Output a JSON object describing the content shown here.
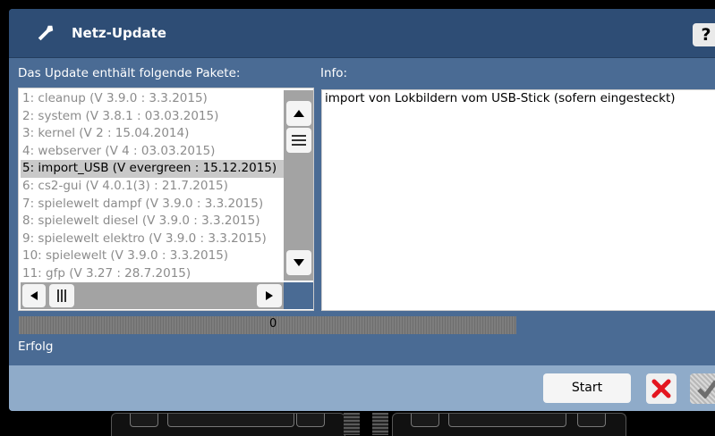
{
  "window": {
    "title": "Netz-Update",
    "help_label": "?"
  },
  "labels": {
    "packages": "Das Update enthält folgende Pakete:",
    "info": "Info:"
  },
  "packages": [
    "1: cleanup (V 3.9.0 : 3.3.2015)",
    "2: system (V 3.8.1 : 03.03.2015)",
    "3: kernel (V 2 : 15.04.2014)",
    "4: webserver (V 4 : 03.03.2015)",
    "5: import_USB (V evergreen : 15.12.2015)",
    "6: cs2-gui (V 4.0.1(3) : 21.7.2015)",
    "7: spielewelt dampf (V 3.9.0 : 3.3.2015)",
    "8: spielewelt diesel (V 3.9.0 : 3.3.2015)",
    "9: spielewelt elektro (V 3.9.0 : 3.3.2015)",
    "10: spielewelt (V 3.9.0 : 3.3.2015)",
    "11: gfp (V 3.27 : 28.7.2015)"
  ],
  "selected_index": 4,
  "info_text": "import von Lokbildern vom USB-Stick (sofern eingesteckt)",
  "progress": {
    "value_label": "0"
  },
  "status_text": "Erfolg",
  "buttons": {
    "start": "Start"
  },
  "icons": {
    "title": "wrench-icon",
    "scroll_up": "triangle-up-icon",
    "scroll_thumb": "menu-lines-icon",
    "scroll_down": "triangle-down-icon",
    "scroll_left": "triangle-left-icon",
    "scroll_right": "triangle-right-icon",
    "cancel": "x-icon",
    "ok": "checkmark-icon"
  },
  "colors": {
    "title_bar": "#2e4d75",
    "window_bg": "#4a6b94",
    "bottom_bar": "#8fabc9",
    "cancel_red": "#e4151f"
  }
}
